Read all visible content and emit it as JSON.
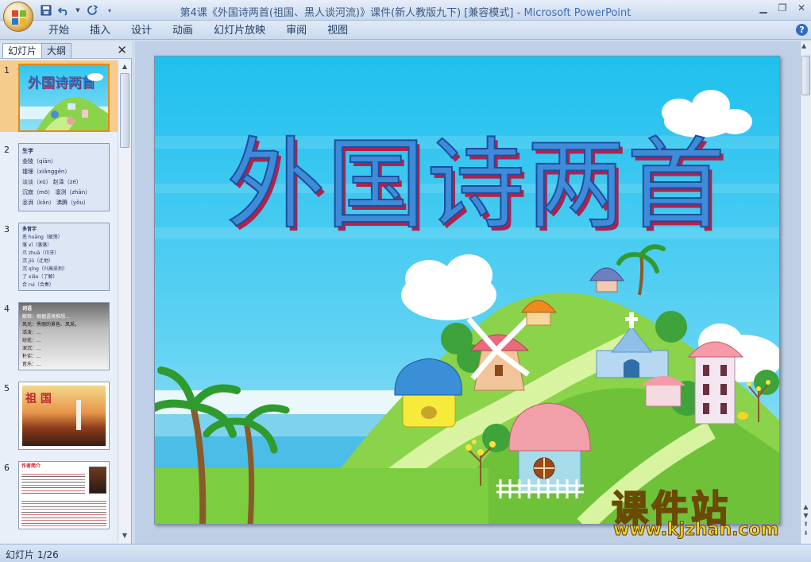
{
  "window": {
    "title": "第4课《外国诗两首(祖国、黑人谈河流)》课件(新人教版九下) [兼容模式]",
    "separator": " - ",
    "app_name": "Microsoft PowerPoint"
  },
  "quick_access": {
    "save": "save-icon",
    "undo": "undo-icon",
    "redo": "redo-icon",
    "customize": "dropdown-icon"
  },
  "ribbon_tabs": [
    "开始",
    "插入",
    "设计",
    "动画",
    "幻灯片放映",
    "审阅",
    "视图"
  ],
  "help_label": "?",
  "left_pane": {
    "tabs": [
      "幻灯片",
      "大纲"
    ],
    "close_label": "✕",
    "thumbnails": [
      {
        "number": "1",
        "title": "外国诗两首"
      },
      {
        "number": "2",
        "lines": [
          "生字",
          "金陵（qiān）",
          "锺理（xiǎnggěn）",
          "淡淡（xū）  赵泽（zé）",
          "沉寂（mō）  凛冽（zhān）",
          "澎湃（kǎn）  沸腾（yǒu）"
        ]
      },
      {
        "number": "3",
        "lines": [
          "多音字",
          "恶 huāng（敲荡）",
          "落 xǐ（落落）",
          "爪 zhuā（爪牙）",
          "沉 jiǔ（迁地）",
          "沉 qǐng（兴高采烈）",
          "了 xiǎo（了解）",
          "合 rui（合奏）"
        ]
      },
      {
        "number": "4",
        "lines": [
          "词语",
          "解释：根据语境推想...",
          "风光：秀丽的景色、风采。",
          "活泼：...",
          "纷扰：...",
          "深沉：...",
          "朴实：...",
          "音乐：..."
        ]
      },
      {
        "number": "5",
        "title": "祖 国"
      },
      {
        "number": "6",
        "lines": [
          "作者简介"
        ]
      }
    ]
  },
  "slide": {
    "title": "外国诗两首"
  },
  "watermark": {
    "cn": "课件站",
    "url": "www.kjzhan.com"
  },
  "status": {
    "slide_indicator": "幻灯片 1/26"
  },
  "colors": {
    "sky": "#2dc7ef",
    "hill": "#8bd34a",
    "title_fill": "#3f8bd8",
    "title_shadow": "#b5204a",
    "selection": "#f6cc8c"
  }
}
